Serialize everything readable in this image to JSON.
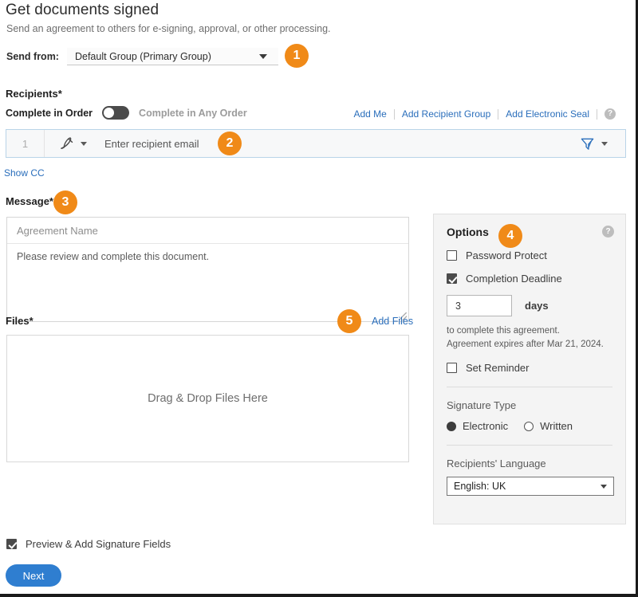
{
  "header": {
    "title": "Get documents signed",
    "subtitle": "Send an agreement to others for e-signing, approval, or other processing."
  },
  "send_from": {
    "label": "Send from:",
    "value": "Default Group (Primary Group)",
    "caret_icon": "chevron-down-icon"
  },
  "badges": {
    "one": "1",
    "two": "2",
    "three": "3",
    "four": "4",
    "five": "5",
    "color": "#f08a18"
  },
  "recipients": {
    "label": "Recipients",
    "required_marker": "*",
    "complete_in_order": "Complete in Order",
    "complete_in_any_order": "Complete in Any Order",
    "toggle_state": "off",
    "links": {
      "add_me": "Add Me",
      "add_recipient_group": "Add Recipient Group",
      "add_electronic_seal": "Add Electronic Seal"
    },
    "help_glyph": "?",
    "row": {
      "number": "1",
      "role_icon": "signature-pen-icon",
      "email_placeholder": "Enter recipient email",
      "filter_icon": "delivery-funnel-icon"
    },
    "show_cc": "Show CC"
  },
  "message": {
    "label": "Message",
    "required_marker": "*",
    "agreement_name_placeholder": "Agreement Name",
    "body_text": "Please review and complete this document."
  },
  "files": {
    "label": "Files",
    "required_marker": "*",
    "add_files": "Add Files",
    "dropzone_text": "Drag & Drop Files Here"
  },
  "options": {
    "title": "Options",
    "help_glyph": "?",
    "password_protect": {
      "label": "Password Protect",
      "checked": false
    },
    "completion_deadline": {
      "label": "Completion Deadline",
      "checked": true
    },
    "days_value": "3",
    "days_unit": "days",
    "note_line1": "to complete this agreement.",
    "note_line2": "Agreement expires after Mar 21, 2024.",
    "set_reminder": {
      "label": "Set Reminder",
      "checked": false
    },
    "signature_type": {
      "title": "Signature Type",
      "electronic": "Electronic",
      "written": "Written",
      "selected": "Electronic"
    },
    "recipients_language": {
      "title": "Recipients' Language",
      "value": "English: UK",
      "caret_icon": "chevron-down-icon"
    }
  },
  "footer": {
    "preview_label": "Preview & Add Signature Fields",
    "preview_checked": true,
    "next_button": "Next",
    "next_color": "#2f7ed0"
  }
}
